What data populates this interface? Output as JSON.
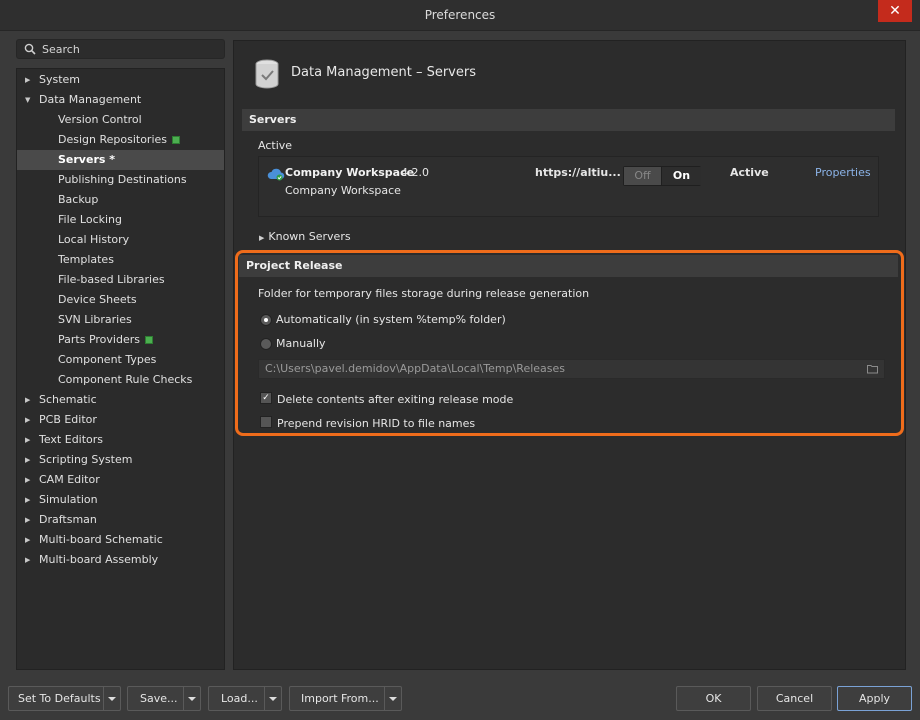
{
  "window": {
    "title": "Preferences",
    "close_glyph": "✕"
  },
  "search": {
    "placeholder": "Search"
  },
  "tree": [
    {
      "label": "System",
      "level": 0,
      "expanded": false
    },
    {
      "label": "Data Management",
      "level": 0,
      "expanded": true
    },
    {
      "label": "Version Control",
      "level": 1
    },
    {
      "label": "Design Repositories",
      "level": 1,
      "badge": true
    },
    {
      "label": "Servers *",
      "level": 1,
      "selected": true
    },
    {
      "label": "Publishing Destinations",
      "level": 1
    },
    {
      "label": "Backup",
      "level": 1
    },
    {
      "label": "File Locking",
      "level": 1
    },
    {
      "label": "Local History",
      "level": 1
    },
    {
      "label": "Templates",
      "level": 1
    },
    {
      "label": "File-based Libraries",
      "level": 1
    },
    {
      "label": "Device Sheets",
      "level": 1
    },
    {
      "label": "SVN Libraries",
      "level": 1
    },
    {
      "label": "Parts Providers",
      "level": 1,
      "badge": true
    },
    {
      "label": "Component Types",
      "level": 1
    },
    {
      "label": "Component Rule Checks",
      "level": 1
    },
    {
      "label": "Schematic",
      "level": 0,
      "expanded": false
    },
    {
      "label": "PCB Editor",
      "level": 0,
      "expanded": false
    },
    {
      "label": "Text Editors",
      "level": 0,
      "expanded": false
    },
    {
      "label": "Scripting System",
      "level": 0,
      "expanded": false
    },
    {
      "label": "CAM Editor",
      "level": 0,
      "expanded": false
    },
    {
      "label": "Simulation",
      "level": 0,
      "expanded": false
    },
    {
      "label": "Draftsman",
      "level": 0,
      "expanded": false
    },
    {
      "label": "Multi-board Schematic",
      "level": 0,
      "expanded": false
    },
    {
      "label": "Multi-board Assembly",
      "level": 0,
      "expanded": false
    }
  ],
  "page": {
    "title": "Data Management – Servers",
    "servers_section": "Servers",
    "active_label": "Active",
    "server": {
      "name": "Company Workspace",
      "version": "4.2.0",
      "subtitle": "Company Workspace",
      "url": "https://altiu...",
      "toggle_off": "Off",
      "toggle_on": "On",
      "status": "Active",
      "properties": "Properties"
    },
    "known_servers": "Known Servers",
    "release_section": "Project Release",
    "folder_label": "Folder for temporary files storage during release generation",
    "option_auto": "Automatically (in system %temp% folder)",
    "option_manual": "Manually",
    "path": "C:\\Users\\pavel.demidov\\AppData\\Local\\Temp\\Releases",
    "delete_contents": "Delete contents after exiting release mode",
    "delete_contents_checked": true,
    "prepend_hrid": "Prepend revision HRID to file names",
    "prepend_hrid_checked": false
  },
  "footer": {
    "set_defaults": "Set To Defaults",
    "save": "Save...",
    "load": "Load...",
    "import_from": "Import From...",
    "ok": "OK",
    "cancel": "Cancel",
    "apply": "Apply"
  },
  "colors": {
    "highlight_frame": "#ef6c1b",
    "link": "#8cb4e8",
    "close": "#c42b1c"
  }
}
